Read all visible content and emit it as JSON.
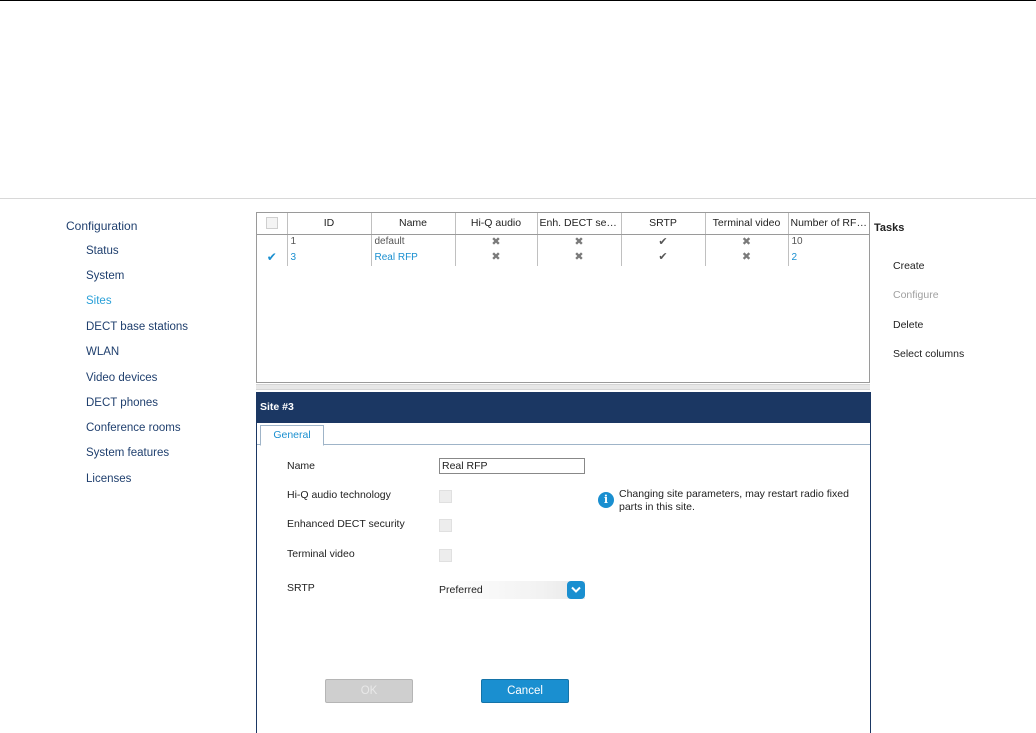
{
  "sidebar": {
    "title": "Configuration",
    "items": [
      {
        "label": "Status"
      },
      {
        "label": "System"
      },
      {
        "label": "Sites",
        "active": true
      },
      {
        "label": "DECT base stations"
      },
      {
        "label": "WLAN"
      },
      {
        "label": "Video devices"
      },
      {
        "label": "DECT phones"
      },
      {
        "label": "Conference rooms"
      },
      {
        "label": "System features"
      },
      {
        "label": "Licenses"
      }
    ]
  },
  "grid": {
    "columns": [
      "ID",
      "Name",
      "Hi-Q audio",
      "Enh. DECT sec...",
      "SRTP",
      "Terminal video",
      "Number of RFPs"
    ],
    "rows": [
      {
        "selected": false,
        "id": "1",
        "name": "default",
        "hiq": "x",
        "enh": "x",
        "srtp": "check",
        "video": "x",
        "rfps": "10"
      },
      {
        "selected": true,
        "id": "3",
        "name": "Real RFP",
        "hiq": "x",
        "enh": "x",
        "srtp": "check",
        "video": "x",
        "rfps": "2"
      }
    ]
  },
  "panel": {
    "title": "Site #3",
    "tab_label": "General",
    "fields": {
      "name_label": "Name",
      "name_value": "Real RFP",
      "hiq_label": "Hi-Q audio technology",
      "enh_label": "Enhanced DECT security",
      "video_label": "Terminal video",
      "srtp_label": "SRTP",
      "srtp_value": "Preferred"
    },
    "info_text": "Changing site parameters, may restart radio fixed parts in this site.",
    "ok_label": "OK",
    "cancel_label": "Cancel"
  },
  "tasks": {
    "title": "Tasks",
    "items": [
      {
        "label": "Create",
        "enabled": true
      },
      {
        "label": "Configure",
        "enabled": false
      },
      {
        "label": "Delete",
        "enabled": true
      },
      {
        "label": "Select columns",
        "enabled": true
      }
    ]
  },
  "colors": {
    "header_bg": "#1b3763",
    "accent": "#1a8fd0",
    "nav_text": "#1f3f6e",
    "disabled_text": "#a0a0a0"
  },
  "icons": {
    "x_mark": "✖",
    "check_mark": "✔",
    "info": "i",
    "dropdown": "chevron-down-icon"
  }
}
